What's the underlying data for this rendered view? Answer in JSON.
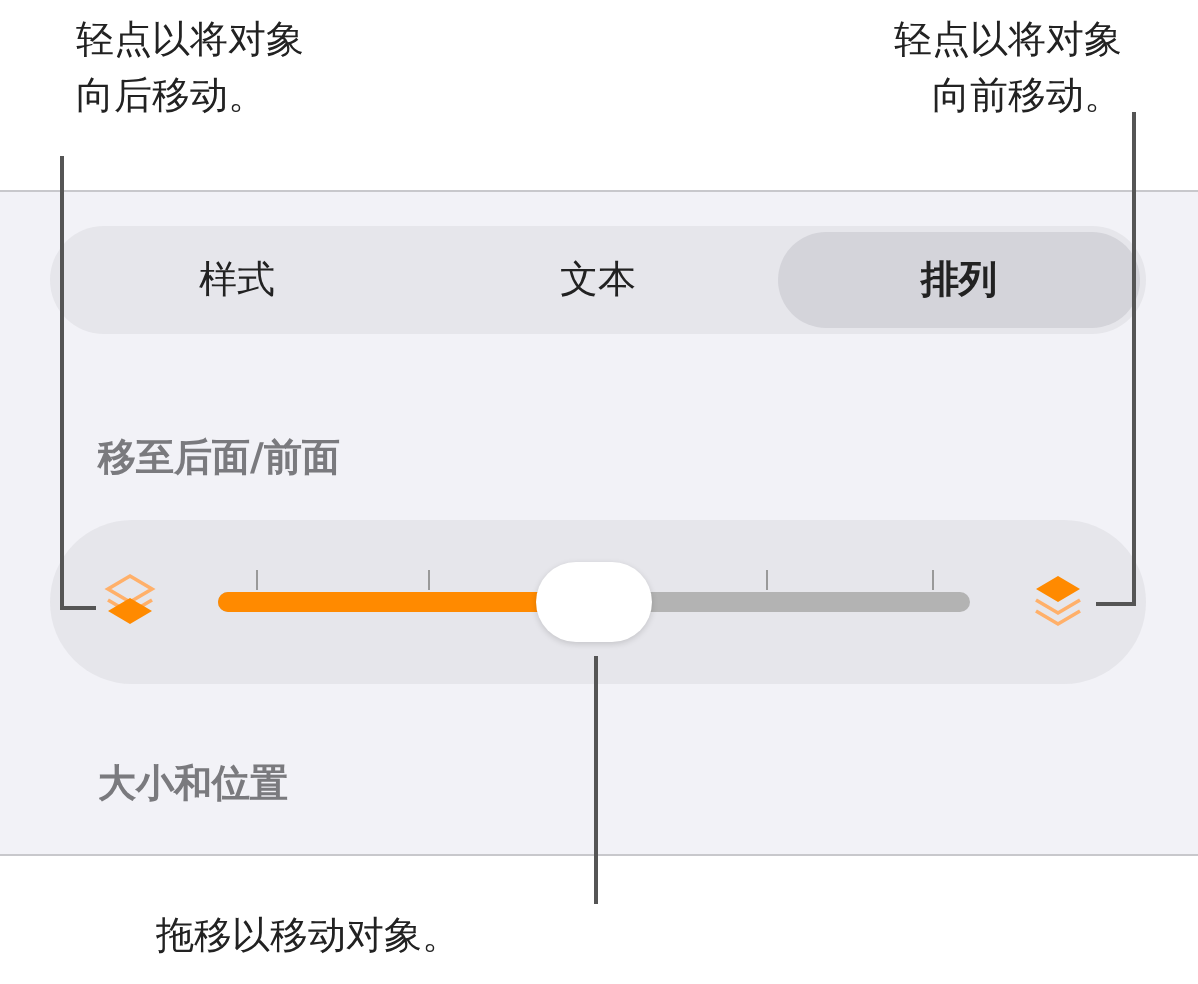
{
  "callout_back": {
    "lines": [
      "轻点以将对象",
      "向后移动。"
    ]
  },
  "callout_front": {
    "lines": [
      "轻点以将对象",
      "向前移动。"
    ]
  },
  "callout_drag": {
    "lines": [
      "拖移以移动对象。"
    ]
  },
  "tabs": [
    {
      "label": "样式",
      "selected": false
    },
    {
      "label": "文本",
      "selected": false
    },
    {
      "label": "排列",
      "selected": true
    }
  ],
  "sections": [
    {
      "title": "移至后面/前面"
    },
    {
      "title": "大小和位置"
    }
  ],
  "slider": {
    "level": 0.5
  }
}
